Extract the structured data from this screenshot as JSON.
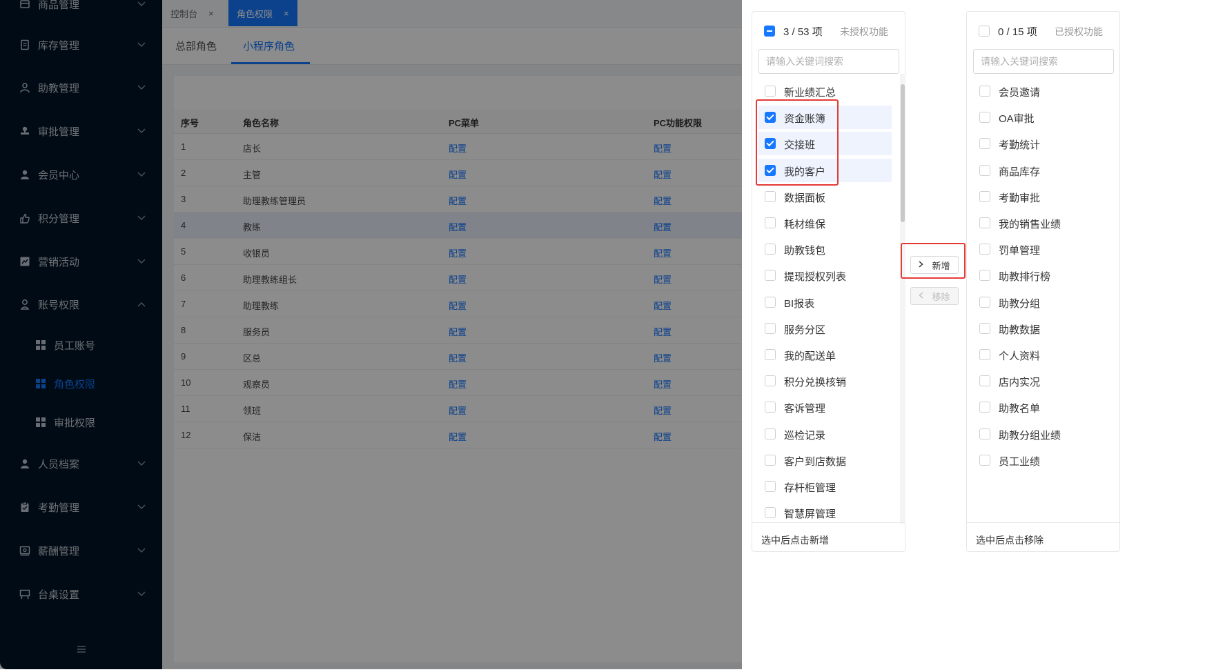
{
  "sidebar": {
    "items": [
      {
        "label": "商品管理",
        "icon": "box-icon"
      },
      {
        "label": "库存管理",
        "icon": "document-icon"
      },
      {
        "label": "助教管理",
        "icon": "user-icon"
      },
      {
        "label": "审批管理",
        "icon": "stamp-icon"
      },
      {
        "label": "会员中心",
        "icon": "member-icon"
      },
      {
        "label": "积分管理",
        "icon": "hand-icon"
      },
      {
        "label": "营销活动",
        "icon": "chart-icon"
      },
      {
        "label": "账号权限",
        "icon": "account-icon"
      },
      {
        "label": "人员档案",
        "icon": "person-icon"
      },
      {
        "label": "考勤管理",
        "icon": "clipboard-icon"
      },
      {
        "label": "薪酬管理",
        "icon": "salary-icon"
      },
      {
        "label": "台桌设置",
        "icon": "table-icon"
      }
    ],
    "sub_items": [
      {
        "label": "员工账号"
      },
      {
        "label": "角色权限"
      },
      {
        "label": "审批权限"
      }
    ]
  },
  "tabs": {
    "console": "控制台",
    "role_perm": "角色权限",
    "close": "×"
  },
  "role_tabs": {
    "hq": "总部角色",
    "mini": "小程序角色"
  },
  "table": {
    "headers": {
      "no": "序号",
      "name": "角色名称",
      "pc_menu": "PC菜单",
      "pc_func": "PC功能权限"
    },
    "link": "配置",
    "rows": [
      {
        "no": "1",
        "name": "店长"
      },
      {
        "no": "2",
        "name": "主管"
      },
      {
        "no": "3",
        "name": "助理教练管理员"
      },
      {
        "no": "4",
        "name": "教练"
      },
      {
        "no": "5",
        "name": "收银员"
      },
      {
        "no": "6",
        "name": "助理教练组长"
      },
      {
        "no": "7",
        "name": "助理教练"
      },
      {
        "no": "8",
        "name": "服务员"
      },
      {
        "no": "9",
        "name": "区总"
      },
      {
        "no": "10",
        "name": "观察员"
      },
      {
        "no": "11",
        "name": "领班"
      },
      {
        "no": "12",
        "name": "保洁"
      }
    ]
  },
  "left_panel": {
    "count": "3 / 53 项",
    "title": "未授权功能",
    "search_placeholder": "请输入关键词搜索",
    "footer": "选中后点击新增",
    "items": [
      {
        "label": "新业绩汇总",
        "checked": false
      },
      {
        "label": "资金账簿",
        "checked": true
      },
      {
        "label": "交接班",
        "checked": true
      },
      {
        "label": "我的客户",
        "checked": true
      },
      {
        "label": "数据面板",
        "checked": false
      },
      {
        "label": "耗材维保",
        "checked": false
      },
      {
        "label": "助教钱包",
        "checked": false
      },
      {
        "label": "提现授权列表",
        "checked": false
      },
      {
        "label": "BI报表",
        "checked": false
      },
      {
        "label": "服务分区",
        "checked": false
      },
      {
        "label": "我的配送单",
        "checked": false
      },
      {
        "label": "积分兑换核销",
        "checked": false
      },
      {
        "label": "客诉管理",
        "checked": false
      },
      {
        "label": "巡检记录",
        "checked": false
      },
      {
        "label": "客户到店数据",
        "checked": false
      },
      {
        "label": "存杆柜管理",
        "checked": false
      },
      {
        "label": "智慧屏管理",
        "checked": false
      }
    ]
  },
  "right_panel": {
    "count": "0 / 15 项",
    "title": "已授权功能",
    "search_placeholder": "请输入关键词搜索",
    "footer": "选中后点击移除",
    "items": [
      {
        "label": "会员邀请"
      },
      {
        "label": "OA审批"
      },
      {
        "label": "考勤统计"
      },
      {
        "label": "商品库存"
      },
      {
        "label": "考勤审批"
      },
      {
        "label": "我的销售业绩"
      },
      {
        "label": "罚单管理"
      },
      {
        "label": "助教排行榜"
      },
      {
        "label": "助教分组"
      },
      {
        "label": "助教数据"
      },
      {
        "label": "个人资料"
      },
      {
        "label": "店内实况"
      },
      {
        "label": "助教名单"
      },
      {
        "label": "助教分组业绩"
      },
      {
        "label": "员工业绩"
      }
    ]
  },
  "operations": {
    "add": "新增",
    "remove": "移除"
  },
  "colors": {
    "sidebar_bg": "#001529",
    "accent": "#1677ff",
    "highlight": "#e53935"
  }
}
